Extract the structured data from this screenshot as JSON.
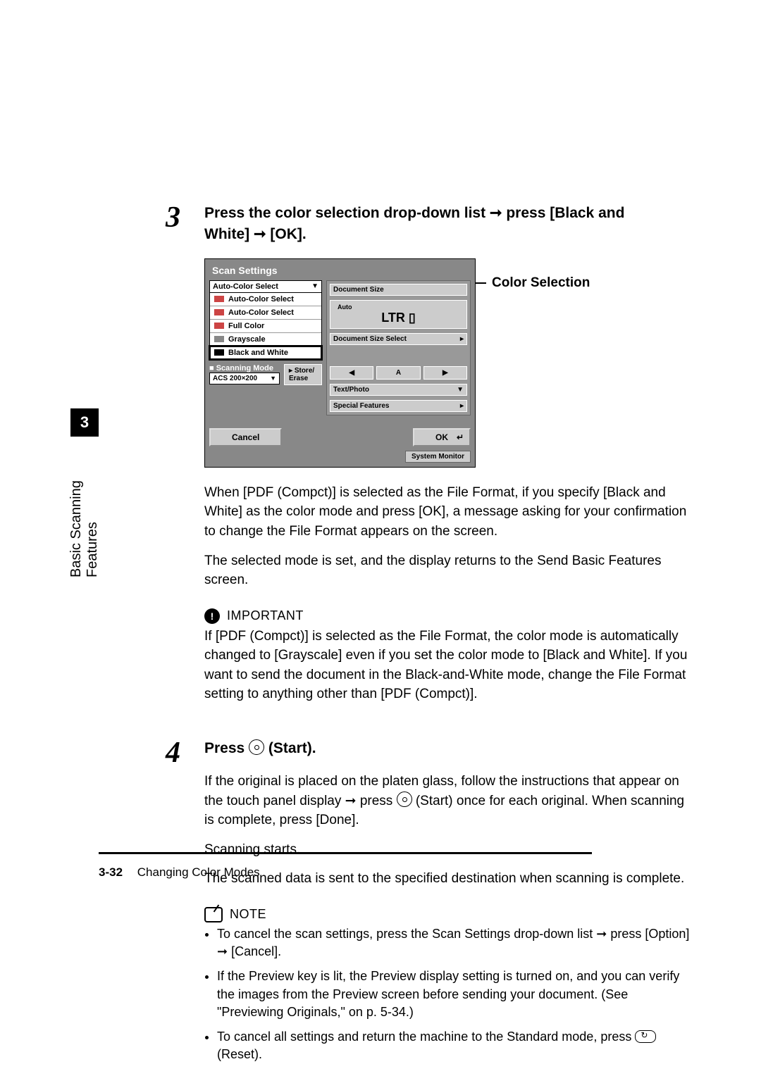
{
  "sidebar": {
    "chapter_num": "3",
    "label": "Basic Scanning Features"
  },
  "step3": {
    "num": "3",
    "title_a": "Press the color selection drop-down list ➞ press [Black and",
    "title_b": "White] ➞ [OK].",
    "callout": "Color Selection",
    "para1": "When [PDF (Compct)] is selected as the File Format, if you specify [Black and White] as the color mode and press [OK], a message asking for your confirmation to change the File Format appears on the screen.",
    "para2": "The selected mode is set, and the display returns to the Send Basic Features screen."
  },
  "panel": {
    "title": "Scan Settings",
    "dd_head": "Auto-Color Select",
    "items": [
      "Auto-Color Select",
      "Auto-Color Select",
      "Full Color",
      "Grayscale",
      "Black and White"
    ],
    "scanning_mode": "Scanning Mode",
    "acs": "ACS  200×200",
    "store": "Store/ Erase",
    "doc_size": "Document Size",
    "auto": "Auto",
    "ltr": "LTR",
    "size_select": "Document Size Select",
    "text_photo": "Text/Photo",
    "special": "Special Features",
    "cancel": "Cancel",
    "ok": "OK",
    "sysmon": "System Monitor"
  },
  "important": {
    "label": "IMPORTANT",
    "text": "If [PDF (Compct)] is selected as the File Format, the color mode is automatically changed to [Grayscale] even if you set the color mode to [Black and White]. If you want to send the document in the Black-and-White mode, change the File Format setting to anything other than [PDF (Compct)]."
  },
  "step4": {
    "num": "4",
    "title_a": "Press ",
    "title_b": " (Start).",
    "para1a": "If the original is placed on the platen glass, follow the instructions that appear on the touch panel display ➞ press ",
    "para1b": " (Start) once for each original. When scanning is complete, press [Done].",
    "para2": "Scanning starts.",
    "para3": "The scanned data is sent to the specified destination when scanning is complete."
  },
  "note": {
    "label": "NOTE",
    "items": [
      "To cancel the scan settings, press the Scan Settings drop-down list ➞ press [Option] ➞ [Cancel].",
      "If the Preview key is lit, the Preview display setting is turned on, and you can verify the images from the Preview screen before sending your document. (See \"Previewing Originals,\" on p. 5-34.)",
      {
        "a": "To cancel all settings and return the machine to the Standard mode, press ",
        "b": " (Reset)."
      }
    ]
  },
  "footer": {
    "page": "3-32",
    "section": "Changing Color Modes"
  }
}
